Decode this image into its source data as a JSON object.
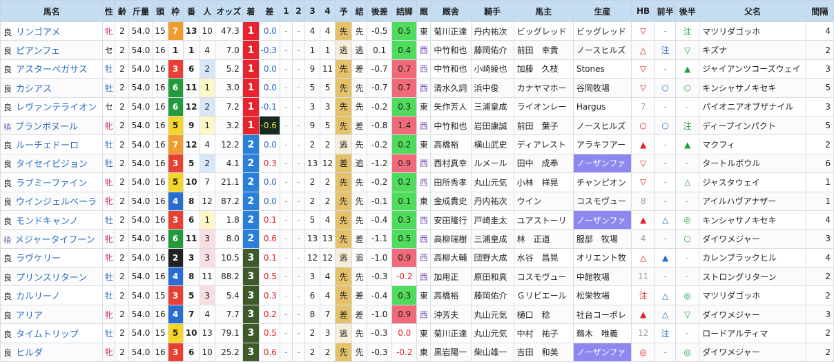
{
  "headers": [
    "馬名",
    "性",
    "齢",
    "斤量",
    "頭",
    "枠",
    "番",
    "人",
    "オッズ",
    "着",
    "差",
    "1",
    "2",
    "3",
    "4",
    "予",
    "結",
    "後差",
    "詰脚",
    "厩",
    "厩舎",
    "騎手",
    "馬主",
    "生産",
    "HB",
    "前半",
    "後半",
    "父名",
    "間隔"
  ],
  "rows": [
    {
      "cond": "良",
      "name": "リンゴアメ",
      "sex": "牝",
      "age": "2",
      "kinryo": "54.0",
      "heads": "15",
      "waku": "7",
      "ban": "13",
      "ninki": "10",
      "odds": "47.3",
      "finish": "1",
      "margin": "0.0",
      "c1": "-",
      "c2": "-",
      "c3": "4",
      "c4": "4",
      "yo": "先",
      "ketsu": "先",
      "atosa": "-0.5",
      "tsumeashi": "0.5",
      "ex": "東",
      "stable": "菊川正達",
      "jockey": "丹内祐次",
      "owner": "ビッグレッド",
      "breeder": "ビッグレッド",
      "hb": "▽",
      "zenhan": "-",
      "kouhan": "注",
      "sire": "マツリダゴッホ",
      "interval": "4"
    },
    {
      "cond": "良",
      "name": "ピアンフェ",
      "sex": "セ",
      "age": "2",
      "kinryo": "54.0",
      "heads": "16",
      "waku": "1",
      "ban": "1",
      "ninki": "4",
      "odds": "7.0",
      "finish": "1",
      "margin": "-0.3",
      "c1": "-",
      "c2": "-",
      "c3": "1",
      "c4": "1",
      "yo": "逃",
      "ketsu": "逃",
      "atosa": "0.1",
      "tsumeashi": "0.4",
      "ex": "西",
      "stable": "中竹和也",
      "jockey": "藤岡佑介",
      "owner": "前田　幸貴",
      "breeder": "ノースヒルズ",
      "hb": "△",
      "zenhan": "注",
      "kouhan": "▽",
      "sire": "キズナ",
      "interval": "2"
    },
    {
      "cond": "良",
      "name": "アスターペガサス",
      "sex": "牡",
      "age": "2",
      "kinryo": "54.0",
      "heads": "16",
      "waku": "3",
      "ban": "6",
      "ninki": "2",
      "odds": "5.2",
      "finish": "1",
      "margin": "0.0",
      "c1": "-",
      "c2": "-",
      "c3": "9",
      "c4": "11",
      "yo": "先",
      "ketsu": "差",
      "atosa": "-0.7",
      "tsumeashi": "0.7",
      "ex": "西",
      "stable": "中竹和也",
      "jockey": "小崎綾也",
      "owner": "加藤　久枝",
      "breeder": "Stones",
      "hb": "▽",
      "zenhan": "-",
      "kouhan": "▲",
      "sire": "ジャイアンツコーズウェイ",
      "interval": "3"
    },
    {
      "cond": "良",
      "name": "カシアス",
      "sex": "牡",
      "age": "2",
      "kinryo": "54.0",
      "heads": "16",
      "waku": "6",
      "ban": "11",
      "ninki": "1",
      "odds": "3.0",
      "finish": "1",
      "margin": "0.0",
      "c1": "-",
      "c2": "-",
      "c3": "5",
      "c4": "5",
      "yo": "先",
      "ketsu": "先",
      "atosa": "-0.7",
      "tsumeashi": "0.7",
      "ex": "西",
      "stable": "清水久詞",
      "jockey": "浜中俊",
      "owner": "カナヤマホー",
      "breeder": "谷岡牧場",
      "hb": "▽",
      "zenhan": "○",
      "kouhan": "○",
      "sire": "キンシャサノキセキ",
      "interval": "5"
    },
    {
      "cond": "良",
      "name": "レヴァンテライオン",
      "sex": "セ",
      "age": "2",
      "kinryo": "54.0",
      "heads": "16",
      "waku": "6",
      "ban": "12",
      "ninki": "2",
      "odds": "7.2",
      "finish": "1",
      "margin": "-0.1",
      "c1": "-",
      "c2": "-",
      "c3": "3",
      "c4": "3",
      "yo": "先",
      "ketsu": "先",
      "atosa": "-0.2",
      "tsumeashi": "0.3",
      "ex": "東",
      "stable": "矢作芳人",
      "jockey": "三浦皇成",
      "owner": "ライオンレー",
      "breeder": "Hargus",
      "hb": "7",
      "zenhan": "-",
      "kouhan": "-",
      "sire": "パイオニアオブザナイル",
      "interval": "3"
    },
    {
      "cond": "稍",
      "name": "ブランボヌール",
      "sex": "牝",
      "age": "2",
      "kinryo": "54.0",
      "heads": "16",
      "waku": "5",
      "ban": "9",
      "ninki": "1",
      "odds": "3.2",
      "finish": "1",
      "margin": "-0.6",
      "c1": "-",
      "c2": "-",
      "c3": "9",
      "c4": "5",
      "yo": "先",
      "ketsu": "差",
      "atosa": "-0.8",
      "tsumeashi": "1.4",
      "ex": "西",
      "stable": "中竹和也",
      "jockey": "岩田康誠",
      "owner": "前田　葉子",
      "breeder": "ノースヒルズ",
      "hb": "○",
      "zenhan": "○",
      "kouhan": "注",
      "sire": "ディープインパクト",
      "interval": "5"
    },
    {
      "cond": "良",
      "name": "ルーチェドーロ",
      "sex": "牡",
      "age": "2",
      "kinryo": "54.0",
      "heads": "16",
      "waku": "7",
      "ban": "12",
      "ninki": "4",
      "odds": "12.2",
      "finish": "2",
      "margin": "0.0",
      "c1": "-",
      "c2": "-",
      "c3": "2",
      "c4": "2",
      "yo": "逃",
      "ketsu": "先",
      "atosa": "-0.2",
      "tsumeashi": "0.2",
      "ex": "東",
      "stable": "高橋裕",
      "jockey": "横山武史",
      "owner": "ディアレスト",
      "breeder": "アラキフアー",
      "hb": "▲",
      "zenhan": "-",
      "kouhan": "▲",
      "sire": "マクフィ",
      "interval": "2"
    },
    {
      "cond": "良",
      "name": "タイセイビジョン",
      "sex": "牡",
      "age": "2",
      "kinryo": "54.0",
      "heads": "16",
      "waku": "3",
      "ban": "5",
      "ninki": "2",
      "odds": "4.1",
      "finish": "2",
      "margin": "0.3",
      "c1": "-",
      "c2": "-",
      "c3": "13",
      "c4": "12",
      "yo": "差",
      "ketsu": "追",
      "atosa": "-1.2",
      "tsumeashi": "0.9",
      "ex": "西",
      "stable": "西村真幸",
      "jockey": "ルメール",
      "owner": "田中　成奉",
      "breeder": "ノーザンファ",
      "hb": "▽",
      "zenhan": "-",
      "kouhan": "-",
      "sire": "タートルボウル",
      "interval": "6"
    },
    {
      "cond": "良",
      "name": "ラブミーファイン",
      "sex": "牝",
      "age": "2",
      "kinryo": "54.0",
      "heads": "16",
      "waku": "5",
      "ban": "10",
      "ninki": "7",
      "odds": "21.1",
      "finish": "2",
      "margin": "0.0",
      "c1": "-",
      "c2": "-",
      "c3": "2",
      "c4": "2",
      "yo": "先",
      "ketsu": "先",
      "atosa": "-0.2",
      "tsumeashi": "0.2",
      "ex": "西",
      "stable": "田所秀孝",
      "jockey": "丸山元気",
      "owner": "小林　祥晃",
      "breeder": "チャンピオン",
      "hb": "▽",
      "zenhan": "-",
      "kouhan": "△",
      "sire": "ジャスタウェイ",
      "interval": "1"
    },
    {
      "cond": "良",
      "name": "ウインジェルベーラ",
      "sex": "牝",
      "age": "2",
      "kinryo": "54.0",
      "heads": "16",
      "waku": "4",
      "ban": "8",
      "ninki": "12",
      "odds": "87.2",
      "finish": "2",
      "margin": "0.0",
      "c1": "-",
      "c2": "-",
      "c3": "2",
      "c4": "2",
      "yo": "先",
      "ketsu": "先",
      "atosa": "-0.1",
      "tsumeashi": "0.1",
      "ex": "東",
      "stable": "金成貴史",
      "jockey": "丹内祐次",
      "owner": "ウイン",
      "breeder": "コスモヴュー",
      "hb": "8",
      "zenhan": "-",
      "kouhan": "-",
      "sire": "アイルハヴアナザー",
      "interval": "1"
    },
    {
      "cond": "良",
      "name": "モンドキャンノ",
      "sex": "牡",
      "age": "2",
      "kinryo": "54.0",
      "heads": "16",
      "waku": "3",
      "ban": "6",
      "ninki": "1",
      "odds": "1.8",
      "finish": "2",
      "margin": "0.1",
      "c1": "-",
      "c2": "-",
      "c3": "5",
      "c4": "4",
      "yo": "先",
      "ketsu": "先",
      "atosa": "-0.4",
      "tsumeashi": "0.3",
      "ex": "西",
      "stable": "安田隆行",
      "jockey": "戸崎圭太",
      "owner": "ユアストーリ",
      "breeder": "ノーザンファ",
      "hb": "▲",
      "zenhan": "△",
      "kouhan": "◎",
      "sire": "キンシャサノキセキ",
      "interval": "4"
    },
    {
      "cond": "稍",
      "name": "メジャータイフーン",
      "sex": "牝",
      "age": "2",
      "kinryo": "54.0",
      "heads": "16",
      "waku": "6",
      "ban": "11",
      "ninki": "3",
      "odds": "8.0",
      "finish": "2",
      "margin": "0.6",
      "c1": "-",
      "c2": "-",
      "c3": "13",
      "c4": "13",
      "yo": "先",
      "ketsu": "差",
      "atosa": "-1.1",
      "tsumeashi": "0.5",
      "ex": "西",
      "stable": "高柳瑞樹",
      "jockey": "三浦皇成",
      "owner": "林　正道",
      "breeder": "服部　牧場",
      "hb": "4",
      "zenhan": "-",
      "kouhan": "○",
      "sire": "ダイワメジャー",
      "interval": "3"
    },
    {
      "cond": "良",
      "name": "ラヴケリー",
      "sex": "牝",
      "age": "2",
      "kinryo": "54.0",
      "heads": "16",
      "waku": "2",
      "ban": "3",
      "ninki": "3",
      "odds": "10.5",
      "finish": "3",
      "margin": "0.1",
      "c1": "-",
      "c2": "-",
      "c3": "12",
      "c4": "12",
      "yo": "逃",
      "ketsu": "追",
      "atosa": "-1.0",
      "tsumeashi": "0.9",
      "ex": "西",
      "stable": "高柳大輔",
      "jockey": "団野大成",
      "owner": "水谷　昌晃",
      "breeder": "オリエント牧",
      "hb": "△",
      "zenhan": "▲",
      "kouhan": "-",
      "sire": "カレンブラックヒル",
      "interval": "4"
    },
    {
      "cond": "良",
      "name": "プリンスリターン",
      "sex": "牡",
      "age": "2",
      "kinryo": "54.0",
      "heads": "16",
      "waku": "4",
      "ban": "8",
      "ninki": "11",
      "odds": "88.2",
      "finish": "3",
      "margin": "0.5",
      "c1": "-",
      "c2": "-",
      "c3": "3",
      "c4": "4",
      "yo": "先",
      "ketsu": "先",
      "atosa": "-0.3",
      "tsumeashi": "-0.2",
      "ex": "西",
      "stable": "加用正",
      "jockey": "原田和真",
      "owner": "コスモヴュー",
      "breeder": "中館牧場",
      "hb": "11",
      "zenhan": "-",
      "kouhan": "-",
      "sire": "ストロングリターン",
      "interval": "2"
    },
    {
      "cond": "良",
      "name": "カルリーノ",
      "sex": "牡",
      "age": "2",
      "kinryo": "54.0",
      "heads": "15",
      "waku": "3",
      "ban": "5",
      "ninki": "3",
      "odds": "5.4",
      "finish": "3",
      "margin": "0.3",
      "c1": "-",
      "c2": "-",
      "c3": "6",
      "c4": "4",
      "yo": "先",
      "ketsu": "差",
      "atosa": "-0.4",
      "tsumeashi": "0.3",
      "ex": "東",
      "stable": "高橋裕",
      "jockey": "藤岡佑介",
      "owner": "Ｇリビエール",
      "breeder": "松栄牧場",
      "hb": "注",
      "zenhan": "△",
      "kouhan": "◎",
      "sire": "マツリダゴッホ",
      "interval": "2"
    },
    {
      "cond": "良",
      "name": "アリア",
      "sex": "牝",
      "age": "2",
      "kinryo": "54.0",
      "heads": "16",
      "waku": "4",
      "ban": "7",
      "ninki": "4",
      "odds": "7.7",
      "finish": "3",
      "margin": "0.2",
      "c1": "-",
      "c2": "-",
      "c3": "8",
      "c4": "7",
      "yo": "差",
      "ketsu": "差",
      "atosa": "-1.0",
      "tsumeashi": "0.9",
      "ex": "西",
      "stable": "沖芳夫",
      "jockey": "丸山元気",
      "owner": "樋口　稔",
      "breeder": "社台コーポレ",
      "hb": "▲",
      "zenhan": "△",
      "kouhan": "▽",
      "sire": "ダイワメジャー",
      "interval": "3"
    },
    {
      "cond": "良",
      "name": "タイムトリップ",
      "sex": "牡",
      "age": "2",
      "kinryo": "54.0",
      "heads": "15",
      "waku": "5",
      "ban": "10",
      "ninki": "13",
      "odds": "79.1",
      "finish": "3",
      "margin": "0.5",
      "c1": "-",
      "c2": "-",
      "c3": "2",
      "c4": "3",
      "yo": "逃",
      "ketsu": "先",
      "atosa": "-0.3",
      "tsumeashi": "0.0",
      "ex": "東",
      "stable": "菊川正達",
      "jockey": "丸山元気",
      "owner": "中村　祐子",
      "breeder": "鵜木　唯義",
      "hb": "12",
      "zenhan": "注",
      "kouhan": "-",
      "sire": "ロードアルティマ",
      "interval": "2"
    },
    {
      "cond": "良",
      "name": "ヒルダ",
      "sex": "牝",
      "age": "2",
      "kinryo": "54.0",
      "heads": "16",
      "waku": "3",
      "ban": "6",
      "ninki": "10",
      "odds": "25.2",
      "finish": "3",
      "margin": "0.6",
      "c1": "-",
      "c2": "-",
      "c3": "2",
      "c4": "2",
      "yo": "先",
      "ketsu": "先",
      "atosa": "-0.3",
      "tsumeashi": "-0.2",
      "ex": "東",
      "stable": "黒岩陽一",
      "jockey": "柴山雄一",
      "owner": "吉田　和美",
      "breeder": "ノーザンファ",
      "hb": "◎",
      "zenhan": "-",
      "kouhan": "◎",
      "sire": "ダイワメジャー",
      "interval": "2"
    }
  ]
}
